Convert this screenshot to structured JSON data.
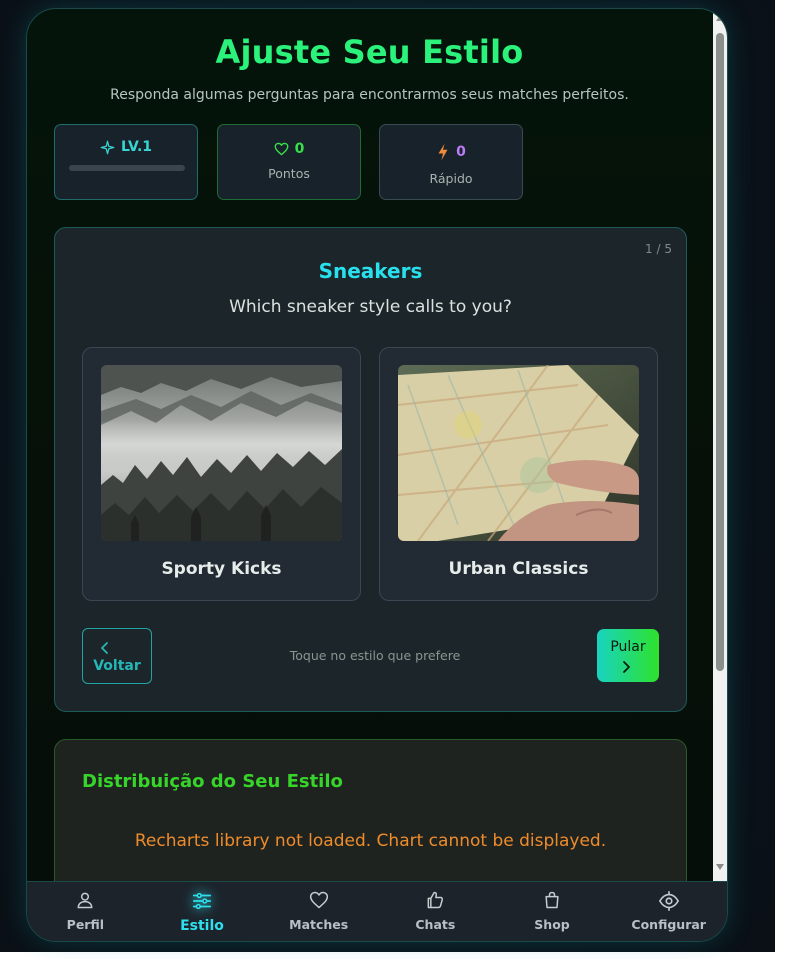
{
  "header": {
    "title": "Ajuste Seu Estilo",
    "subtitle": "Responda algumas perguntas para encontrarmos seus matches perfeitos."
  },
  "stats": {
    "level": {
      "label": "LV.1",
      "icon": "sparkle-icon",
      "progress": 0
    },
    "points": {
      "value": "0",
      "label": "Pontos",
      "icon": "heart-icon"
    },
    "fast": {
      "value": "0",
      "label": "Rápido",
      "icon": "lightning-icon"
    }
  },
  "quiz": {
    "counter": "1 / 5",
    "category": "Sneakers",
    "question": "Which sneaker style calls to you?",
    "options": [
      {
        "label": "Sporty Kicks",
        "image": "misty-forest-photo"
      },
      {
        "label": "Urban Classics",
        "image": "hands-holding-map-photo"
      }
    ],
    "back_label": "Voltar",
    "hint": "Toque no estilo que prefere",
    "skip_label": "Pular"
  },
  "distribution": {
    "title": "Distribuição do Seu Estilo",
    "message": "Recharts library not loaded. Chart cannot be displayed."
  },
  "nav": {
    "items": [
      {
        "label": "Perfil",
        "icon": "user-icon"
      },
      {
        "label": "Estilo",
        "icon": "sliders-icon",
        "active": true
      },
      {
        "label": "Matches",
        "icon": "heart-icon"
      },
      {
        "label": "Chats",
        "icon": "thumbs-up-icon"
      },
      {
        "label": "Shop",
        "icon": "shopping-bag-icon"
      },
      {
        "label": "Configurar",
        "icon": "settings-eye-icon"
      }
    ]
  },
  "colors": {
    "accent_green": "#2af27a",
    "accent_cyan": "#28e0ee",
    "warning_orange": "#ee8c2c"
  }
}
